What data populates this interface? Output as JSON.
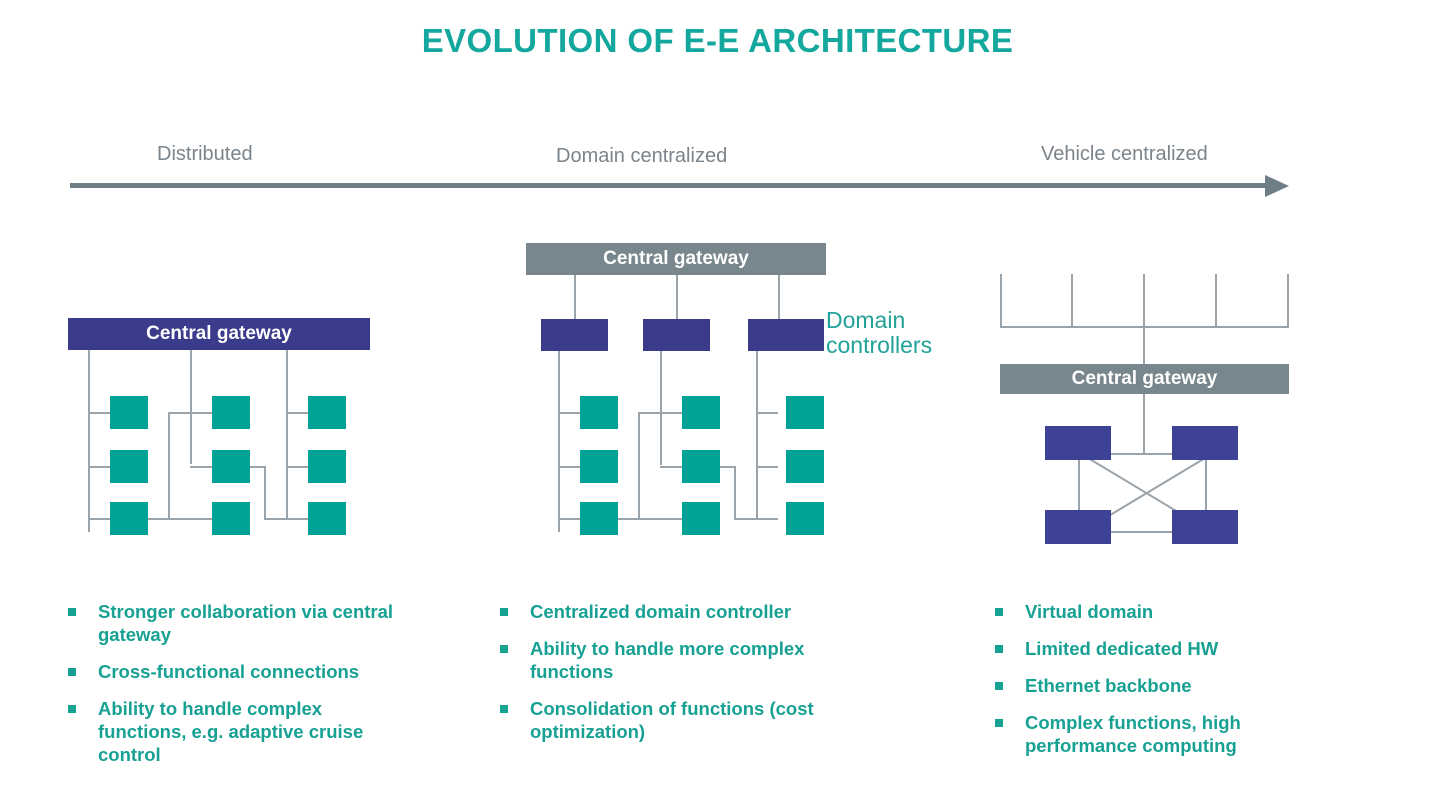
{
  "title": "EVOLUTION OF E-E ARCHITECTURE",
  "timeline": {
    "stages": [
      {
        "label": "Distributed"
      },
      {
        "label": "Domain centralized"
      },
      {
        "label": "Vehicle centralized"
      }
    ]
  },
  "colors": {
    "title_teal": "#13a79d",
    "bullet_teal": "#17a193",
    "ecu_teal": "#00a396",
    "gateway_blue": "#3b3b8c",
    "gateway_gray": "#78868d",
    "node_blue": "#3e4296",
    "wire_gray": "#9aa3aa",
    "stage_label_gray": "#7b848b"
  },
  "diagrams": {
    "distributed": {
      "gateway_label": "Central gateway",
      "gateway_style": "blue",
      "ecu_count": 9
    },
    "domain_centralized": {
      "gateway_label": "Central gateway",
      "gateway_style": "gray",
      "domain_controllers_label": "Domain\ncontrollers",
      "domain_controller_count": 3,
      "ecu_count": 9
    },
    "vehicle_centralized": {
      "gateway_label": "Central gateway",
      "gateway_style": "gray",
      "backbone_teeth": 5,
      "node_count": 4
    }
  },
  "columns": [
    {
      "bullets": [
        "Stronger collaboration via central gateway",
        "Cross-functional connections",
        "Ability to handle complex functions, e.g. adaptive cruise control"
      ]
    },
    {
      "bullets": [
        "Centralized domain controller",
        "Ability to handle more complex functions",
        "Consolidation of functions (cost optimization)"
      ]
    },
    {
      "bullets": [
        "Virtual domain",
        "Limited dedicated HW",
        "Ethernet backbone",
        "Complex functions, high performance computing"
      ]
    }
  ]
}
